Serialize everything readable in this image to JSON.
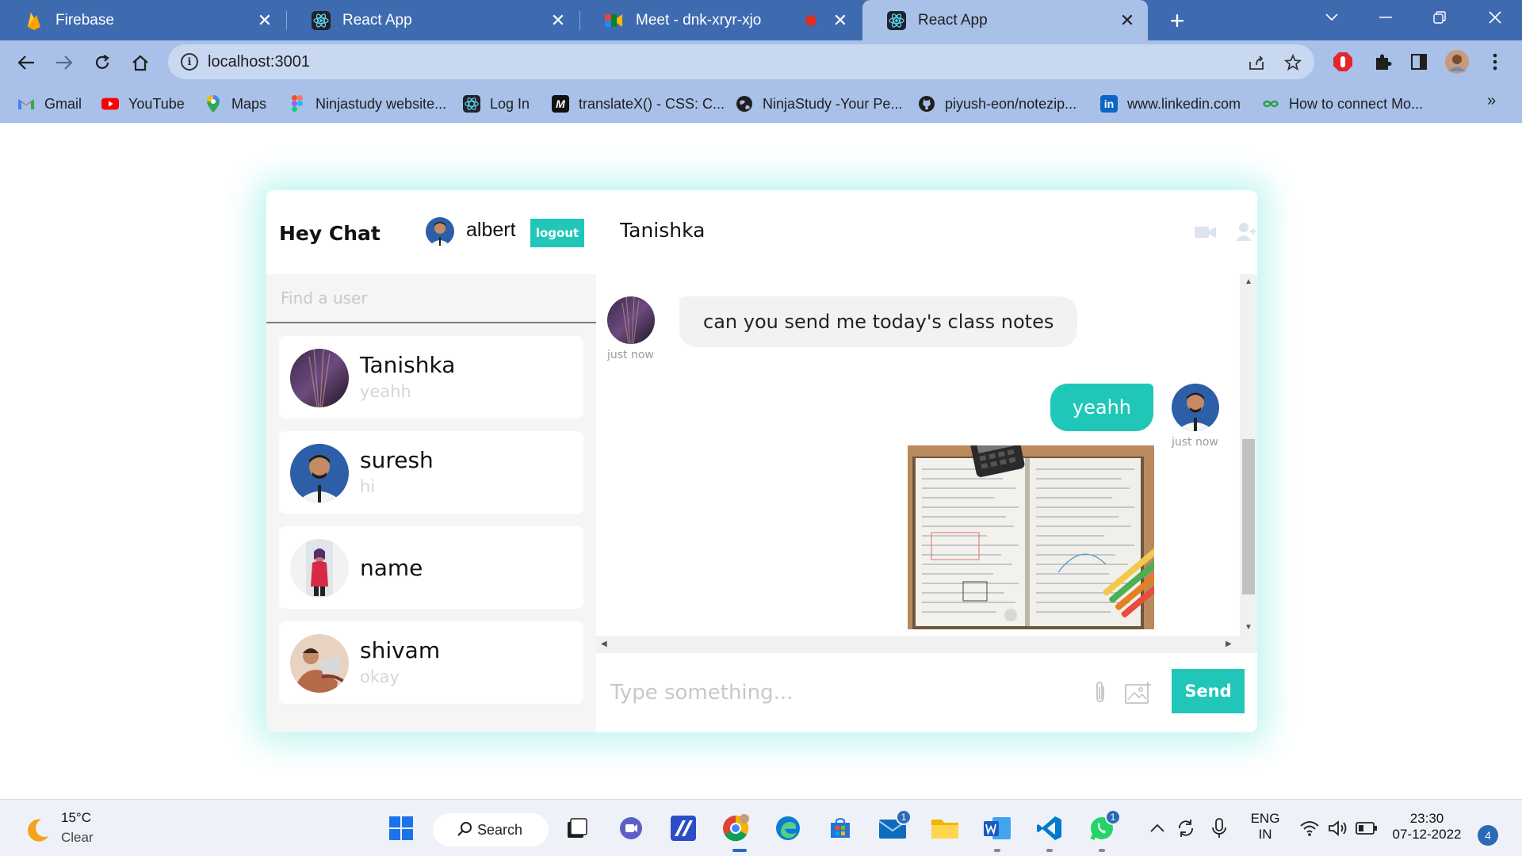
{
  "browser": {
    "tabs": [
      {
        "title": "Firebase",
        "close": "✕"
      },
      {
        "title": "React App",
        "close": "✕"
      },
      {
        "title": "Meet - dnk-xryr-xjo",
        "close": "✕"
      },
      {
        "title": "React App",
        "close": "✕"
      }
    ],
    "new_tab": "+",
    "url": "localhost:3001",
    "bookmarks": [
      {
        "label": "Gmail",
        "icon": "gmail-icon"
      },
      {
        "label": "YouTube",
        "icon": "youtube-icon"
      },
      {
        "label": "Maps",
        "icon": "maps-icon"
      },
      {
        "label": "Ninjastudy website...",
        "icon": "figma-icon"
      },
      {
        "label": "Log In",
        "icon": "react-icon"
      },
      {
        "label": "translateX() - CSS: C...",
        "icon": "mdn-icon"
      },
      {
        "label": "NinjaStudy -Your Pe...",
        "icon": "globe-icon"
      },
      {
        "label": "piyush-eon/notezip...",
        "icon": "github-icon"
      },
      {
        "label": "www.linkedin.com",
        "icon": "linkedin-icon"
      },
      {
        "label": "How to connect Mo...",
        "icon": "link-icon"
      }
    ],
    "bookmarks_more": "»"
  },
  "app": {
    "brand": "Hey Chat",
    "current_user": "albert",
    "logout_label": "logout",
    "search_placeholder": "Find a user",
    "users": [
      {
        "name": "Tanishka",
        "last_message": "yeahh"
      },
      {
        "name": "suresh",
        "last_message": "hi"
      },
      {
        "name": "name",
        "last_message": ""
      },
      {
        "name": "shivam",
        "last_message": "okay"
      }
    ],
    "chat": {
      "title": "Tanishka",
      "messages": [
        {
          "from": "them",
          "text": "can you send me today's class notes",
          "time": "just now"
        },
        {
          "from": "me",
          "text": "yeahh",
          "time": "just now",
          "has_image": true
        }
      ],
      "composer_placeholder": "Type something...",
      "send_label": "Send"
    },
    "accent_color": "#20c7b8"
  },
  "taskbar": {
    "weather_temp": "15°C",
    "weather_cond": "Clear",
    "search_label": "Search",
    "mail_badge": "1",
    "whatsapp_badge": "1",
    "lang_line1": "ENG",
    "lang_line2": "IN",
    "time": "23:30",
    "date": "07-12-2022",
    "notifications": "4"
  }
}
